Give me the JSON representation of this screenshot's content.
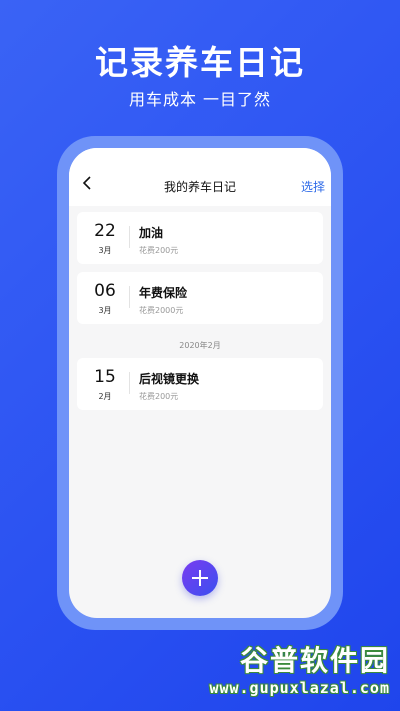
{
  "hero": {
    "title": "记录养车日记",
    "subtitle": "用车成本  一目了然"
  },
  "navbar": {
    "title": "我的养车日记",
    "select_label": "选择",
    "back_icon": "chevron-left-icon"
  },
  "entries": [
    {
      "day": "22",
      "month": "3月",
      "title": "加油",
      "cost": "花费200元"
    },
    {
      "day": "06",
      "month": "3月",
      "title": "年费保险",
      "cost": "花费2000元"
    },
    {
      "day": "15",
      "month": "2月",
      "title": "后视镜更换",
      "cost": "花费200元"
    }
  ],
  "section_label": "2020年2月",
  "fab": {
    "icon": "plus-icon"
  },
  "watermark": {
    "text": "谷普软件园",
    "url": "www.gupuxlazal.com"
  },
  "colors": {
    "background": "#2b52f2",
    "accent": "#2f6be8",
    "fab_start": "#7a3cf0",
    "fab_end": "#3a4ff0"
  }
}
